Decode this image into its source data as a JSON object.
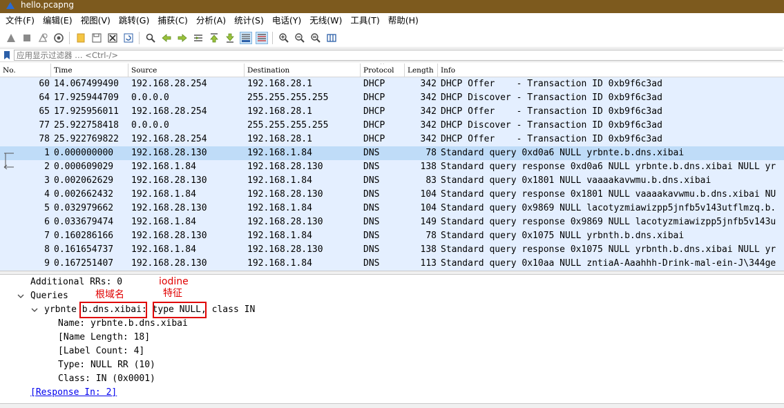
{
  "window": {
    "title": "hello.pcapng"
  },
  "menu": [
    {
      "label": "文件(F)"
    },
    {
      "label": "编辑(E)"
    },
    {
      "label": "视图(V)"
    },
    {
      "label": "跳转(G)"
    },
    {
      "label": "捕获(C)"
    },
    {
      "label": "分析(A)"
    },
    {
      "label": "统计(S)"
    },
    {
      "label": "电话(Y)"
    },
    {
      "label": "无线(W)"
    },
    {
      "label": "工具(T)"
    },
    {
      "label": "帮助(H)"
    }
  ],
  "toolbar_icons": [
    "shark-fin-start-icon",
    "stop-capture-icon",
    "restart-capture-icon",
    "capture-options-icon",
    "open-file-icon",
    "save-file-icon",
    "close-file-icon",
    "reload-file-icon",
    "find-packet-icon",
    "go-back-icon",
    "go-forward-icon",
    "go-to-packet-icon",
    "go-first-icon",
    "go-last-icon",
    "auto-scroll-icon",
    "colorize-icon",
    "zoom-in-icon",
    "zoom-out-icon",
    "zoom-normal-icon",
    "resize-columns-icon"
  ],
  "filter": {
    "placeholder": "应用显示过滤器 … <Ctrl-/>"
  },
  "columns": [
    "No.",
    "Time",
    "Source",
    "Destination",
    "Protocol",
    "Length",
    "Info"
  ],
  "packets": [
    {
      "no": "60",
      "time": "14.067499490",
      "src": "192.168.28.254",
      "dst": "192.168.28.1",
      "proto": "DHCP",
      "len": "342",
      "info": "DHCP Offer    - Transaction ID 0xb9f6c3ad"
    },
    {
      "no": "64",
      "time": "17.925944709",
      "src": "0.0.0.0",
      "dst": "255.255.255.255",
      "proto": "DHCP",
      "len": "342",
      "info": "DHCP Discover - Transaction ID 0xb9f6c3ad"
    },
    {
      "no": "65",
      "time": "17.925956011",
      "src": "192.168.28.254",
      "dst": "192.168.28.1",
      "proto": "DHCP",
      "len": "342",
      "info": "DHCP Offer    - Transaction ID 0xb9f6c3ad"
    },
    {
      "no": "77",
      "time": "25.922758418",
      "src": "0.0.0.0",
      "dst": "255.255.255.255",
      "proto": "DHCP",
      "len": "342",
      "info": "DHCP Discover - Transaction ID 0xb9f6c3ad"
    },
    {
      "no": "78",
      "time": "25.922769822",
      "src": "192.168.28.254",
      "dst": "192.168.28.1",
      "proto": "DHCP",
      "len": "342",
      "info": "DHCP Offer    - Transaction ID 0xb9f6c3ad"
    },
    {
      "no": "1",
      "time": "0.000000000",
      "src": "192.168.28.130",
      "dst": "192.168.1.84",
      "proto": "DNS",
      "len": "78",
      "info": "Standard query 0xd0a6 NULL yrbnte.b.dns.xibai"
    },
    {
      "no": "2",
      "time": "0.000609029",
      "src": "192.168.1.84",
      "dst": "192.168.28.130",
      "proto": "DNS",
      "len": "138",
      "info": "Standard query response 0xd0a6 NULL yrbnte.b.dns.xibai NULL yr"
    },
    {
      "no": "3",
      "time": "0.002062629",
      "src": "192.168.28.130",
      "dst": "192.168.1.84",
      "proto": "DNS",
      "len": "83",
      "info": "Standard query 0x1801 NULL vaaaakavwmu.b.dns.xibai"
    },
    {
      "no": "4",
      "time": "0.002662432",
      "src": "192.168.1.84",
      "dst": "192.168.28.130",
      "proto": "DNS",
      "len": "104",
      "info": "Standard query response 0x1801 NULL vaaaakavwmu.b.dns.xibai NU"
    },
    {
      "no": "5",
      "time": "0.032979662",
      "src": "192.168.28.130",
      "dst": "192.168.1.84",
      "proto": "DNS",
      "len": "104",
      "info": "Standard query 0x9869 NULL lacotyzmiawizpp5jnfb5v143utflmzq.b."
    },
    {
      "no": "6",
      "time": "0.033679474",
      "src": "192.168.1.84",
      "dst": "192.168.28.130",
      "proto": "DNS",
      "len": "149",
      "info": "Standard query response 0x9869 NULL lacotyzmiawizpp5jnfb5v143u"
    },
    {
      "no": "7",
      "time": "0.160286166",
      "src": "192.168.28.130",
      "dst": "192.168.1.84",
      "proto": "DNS",
      "len": "78",
      "info": "Standard query 0x1075 NULL yrbnth.b.dns.xibai"
    },
    {
      "no": "8",
      "time": "0.161654737",
      "src": "192.168.1.84",
      "dst": "192.168.28.130",
      "proto": "DNS",
      "len": "138",
      "info": "Standard query response 0x1075 NULL yrbnth.b.dns.xibai NULL yr"
    },
    {
      "no": "9",
      "time": "0.167251407",
      "src": "192.168.28.130",
      "dst": "192.168.1.84",
      "proto": "DNS",
      "len": "113",
      "info": "Standard query 0x10aa NULL zntiaA-Aaahhh-Drink-mal-ein-J\\344ge"
    }
  ],
  "details": {
    "additional_rrs": "Additional RRs: 0",
    "queries": "Queries",
    "query_prefix": "yrbnte ",
    "query_domain": "b.dns.xibai",
    "query_sep": ": ",
    "query_type": "type NULL",
    "query_suffix": ", class IN",
    "name": "Name: yrbnte.b.dns.xibai",
    "name_length": "[Name Length: 18]",
    "label_count": "[Label Count: 4]",
    "type": "Type: NULL RR (10)",
    "class": "Class: IN (0x0001)",
    "response_in": "[Response In: 2]"
  },
  "annotations": {
    "root_domain": "根域名",
    "iodine": "iodine",
    "feature": "特征"
  },
  "colors": {
    "titlebar": "#7d5a1e",
    "selected_row": "#bfdcf8",
    "row_bg": "#e4efff",
    "annotation": "#e00000"
  }
}
